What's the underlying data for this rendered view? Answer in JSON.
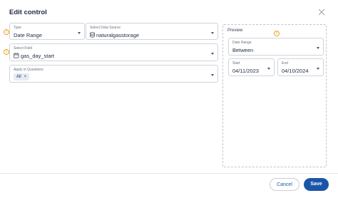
{
  "dialog": {
    "title": "Edit control",
    "close_icon": "close-icon"
  },
  "form": {
    "type": {
      "label": "Type",
      "value": "Date Range"
    },
    "data_source": {
      "label": "Select Data Source",
      "value": "naturalgasstorage",
      "icon": "database-icon"
    },
    "field": {
      "label": "Select Field",
      "value": "gas_day_start",
      "icon": "calendar-field-icon"
    },
    "apply_in": {
      "label": "Apply in Questions",
      "chip": "All",
      "chip_remove": "×"
    }
  },
  "preview": {
    "title": "Preview",
    "date_range": {
      "label": "Date Range",
      "value": "Between"
    },
    "start": {
      "label": "Start",
      "value": "04/11/2023"
    },
    "end": {
      "label": "End",
      "value": "04/10/2024"
    }
  },
  "footer": {
    "cancel_label": "Cancel",
    "save_label": "Save"
  },
  "colors": {
    "accent": "#1a56a8",
    "info": "#f0a020"
  }
}
